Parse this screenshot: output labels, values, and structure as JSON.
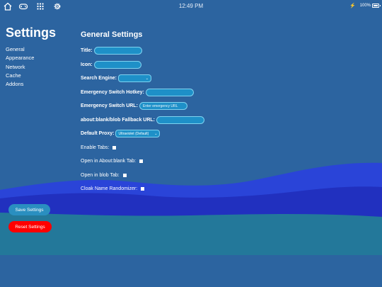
{
  "status_bar": {
    "time": "12:49 PM",
    "battery_text": "100%",
    "icons": [
      "home-icon",
      "gamepad-icon",
      "grid-icon",
      "gear-icon"
    ]
  },
  "sidebar": {
    "title": "Settings",
    "items": [
      {
        "label": "General"
      },
      {
        "label": "Appearance"
      },
      {
        "label": "Network"
      },
      {
        "label": "Cache"
      },
      {
        "label": "Addons"
      }
    ]
  },
  "main": {
    "title": "General Settings",
    "fields": {
      "title_label": "Title:",
      "title_value": "",
      "icon_label": "Icon:",
      "icon_value": "",
      "search_engine_label": "Search Engine:",
      "search_engine_value": "",
      "hotkey_label": "Emergency Switch Hotkey:",
      "hotkey_value": "",
      "url_label": "Emergency Switch URL:",
      "url_placeholder": "Enter emergency URL",
      "fallback_label": "about:blank/blob Fallback URL:",
      "fallback_value": "",
      "proxy_label": "Default Proxy:",
      "proxy_value": "Ultraviolet (Default)"
    },
    "checkboxes": {
      "enable_tabs": "Enable Tabs:",
      "open_aboutblank": "Open in About:blank Tab:",
      "open_blob": "Open in blob Tab:",
      "cloak_randomizer": "Cloak Name Randomizer:"
    }
  },
  "buttons": {
    "save": "Save Settings",
    "reset": "Reset Settings"
  },
  "colors": {
    "background": "#2c64a0",
    "wave_light": "#2a44d8",
    "wave_dark": "#2130bf",
    "teal_band": "#23789a",
    "save_button": "#2a8fc0",
    "reset_button": "#ff0000"
  }
}
